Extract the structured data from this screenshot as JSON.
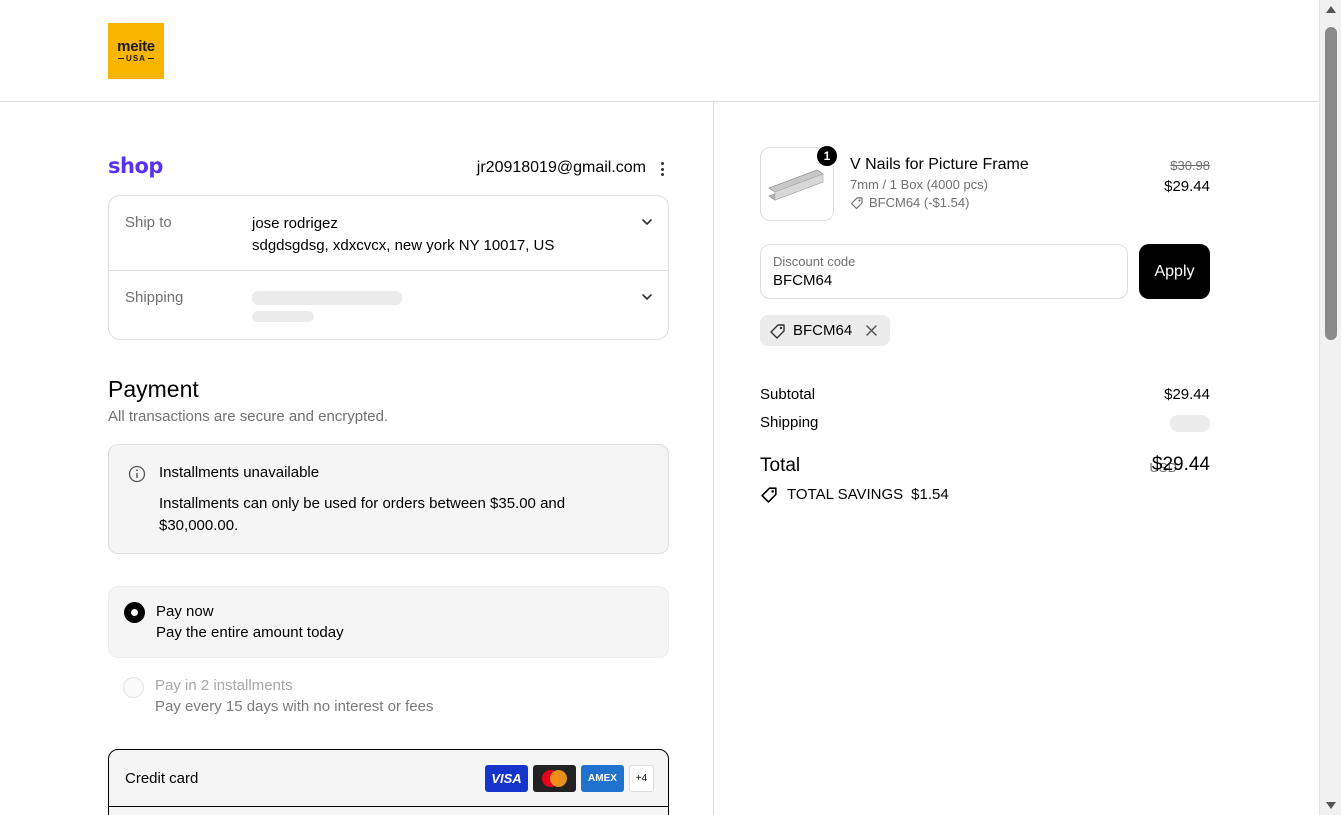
{
  "brand": {
    "logo_line1": "meite",
    "logo_line2": "USA"
  },
  "shop": {
    "logo_text": "shop",
    "account_email": "jr20918019@gmail.com"
  },
  "review": {
    "ship_to_label": "Ship to",
    "ship_to_name": "jose rodrigez",
    "ship_to_address": "sdgdsgdsg, xdxcvcx, new york NY 10017, US",
    "shipping_label": "Shipping"
  },
  "payment": {
    "title": "Payment",
    "subtitle": "All transactions are secure and encrypted.",
    "notice_title": "Installments unavailable",
    "notice_body": "Installments can only be used for orders between $35.00 and $30,000.00.",
    "options": [
      {
        "title": "Pay now",
        "subtitle": "Pay the entire amount today",
        "selected": true
      },
      {
        "title": "Pay in 2 installments",
        "subtitle": "Pay every 15 days with no interest or fees",
        "selected": false
      }
    ],
    "credit_card_label": "Credit card",
    "card_brands": [
      "VISA",
      "mastercard",
      "AMEX",
      "+4"
    ]
  },
  "order": {
    "quantity": "1",
    "product_name": "V Nails for Picture Frame",
    "variant": "7mm / 1 Box (4000 pcs)",
    "line_discount": "BFCM64 (-$1.54)",
    "original_price": "$30.98",
    "price": "$29.44"
  },
  "discount": {
    "label": "Discount code",
    "value": "BFCM64",
    "apply_label": "Apply",
    "applied_code": "BFCM64"
  },
  "summary": {
    "subtotal_label": "Subtotal",
    "subtotal_value": "$29.44",
    "shipping_label": "Shipping",
    "total_label": "Total",
    "currency": "USD",
    "total_value": "$29.44",
    "savings_label": "TOTAL SAVINGS",
    "savings_value": "$1.54"
  },
  "colors": {
    "shop_purple": "#5a31f4",
    "logo_yellow": "#f7b500",
    "visa_blue": "#1434cb",
    "amex_blue": "#1f72cd"
  }
}
